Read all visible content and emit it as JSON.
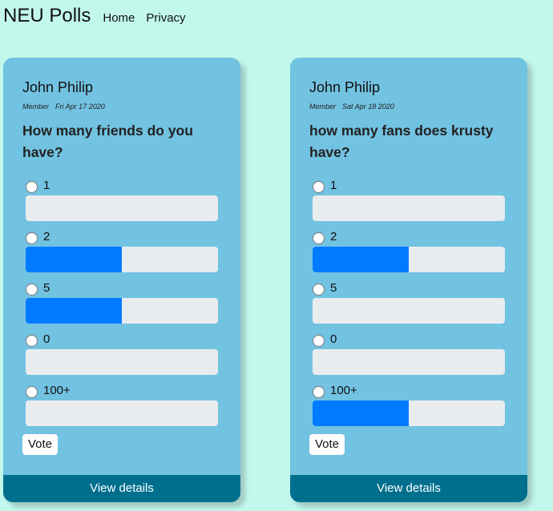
{
  "nav": {
    "brand": "NEU Polls",
    "links": [
      "Home",
      "Privacy"
    ]
  },
  "colors": {
    "background": "#c2f7ec",
    "card": "#72c2e1",
    "bar_fill": "#007bff",
    "bar_track": "#e9ecef",
    "footer": "#006f8e"
  },
  "polls": [
    {
      "author": "John Philip",
      "role": "Member",
      "date": "Fri Apr 17 2020",
      "question": "How many friends do you have?",
      "options": [
        {
          "label": "1",
          "share": 0
        },
        {
          "label": "2",
          "share": 0.5
        },
        {
          "label": "5",
          "share": 0.5
        },
        {
          "label": "0",
          "share": 0
        },
        {
          "label": "100+",
          "share": 0
        }
      ],
      "vote_label": "Vote",
      "details_label": "View details"
    },
    {
      "author": "John Philip",
      "role": "Member",
      "date": "Sat Apr 18 2020",
      "question": "how many fans does krusty have?",
      "options": [
        {
          "label": "1",
          "share": 0
        },
        {
          "label": "2",
          "share": 0.5
        },
        {
          "label": "5",
          "share": 0
        },
        {
          "label": "0",
          "share": 0
        },
        {
          "label": "100+",
          "share": 0.5
        }
      ],
      "vote_label": "Vote",
      "details_label": "View details"
    }
  ]
}
